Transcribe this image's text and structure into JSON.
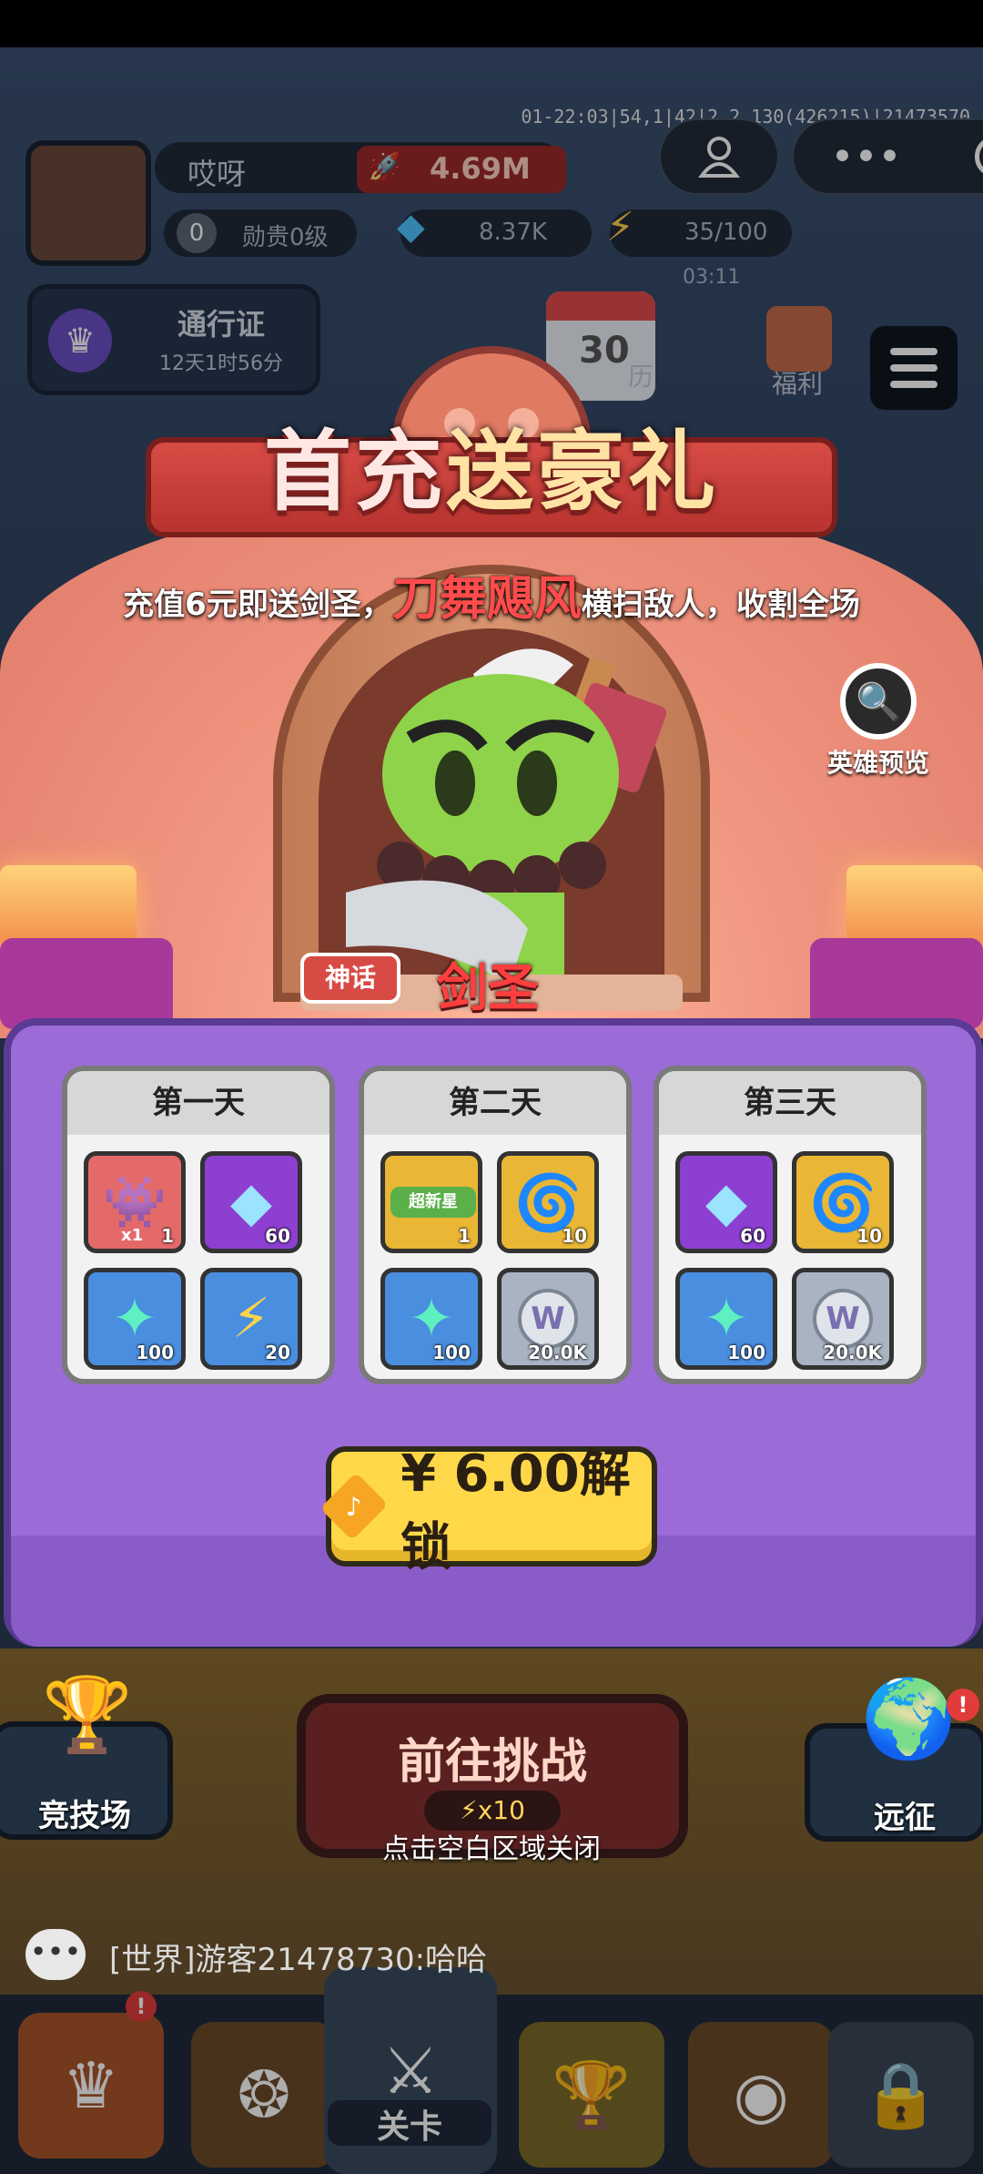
{
  "debug": {
    "info": "01-22:03|54,1|42|2.2.130(426215)|21473570"
  },
  "player": {
    "name": "哎呀",
    "power": "4.69M",
    "medal_level": "勋贵0级",
    "medal_number": "0",
    "gems": "8.37K",
    "energy": "35/100",
    "energy_timer": "03:11"
  },
  "pass": {
    "label": "通行证",
    "timer": "12天1时56分"
  },
  "hud": {
    "calendar_day": "30",
    "calendar_label": "历",
    "welfare": "福利"
  },
  "popup": {
    "title_a": "首充",
    "title_b": "送豪礼",
    "subtitle_pre": "充值6元即送剑圣，",
    "subtitle_highlight": "刀舞飓风",
    "subtitle_post": "横扫敌人，收割全场",
    "hero_preview": "英雄预览",
    "rarity_badge": "神话",
    "hero_name": "剑圣",
    "days": [
      {
        "title": "第一天",
        "items": [
          {
            "icon": "hero-card-icon",
            "qty": "1",
            "badge": "x1"
          },
          {
            "icon": "diamond-icon",
            "qty": "60"
          },
          {
            "icon": "star-shard-icon",
            "qty": "100"
          },
          {
            "icon": "lightning-icon",
            "qty": "20"
          }
        ]
      },
      {
        "title": "第二天",
        "items": [
          {
            "icon": "super-new-ticket-icon",
            "qty": "1",
            "badge": "超新星"
          },
          {
            "icon": "swirl-card-icon",
            "qty": "10"
          },
          {
            "icon": "star-shard-icon",
            "qty": "100"
          },
          {
            "icon": "w-coin-icon",
            "qty": "20.0K"
          }
        ]
      },
      {
        "title": "第三天",
        "items": [
          {
            "icon": "diamond-icon",
            "qty": "60"
          },
          {
            "icon": "swirl-card-icon",
            "qty": "10"
          },
          {
            "icon": "star-shard-icon",
            "qty": "100"
          },
          {
            "icon": "w-coin-icon",
            "qty": "20.0K"
          }
        ]
      }
    ],
    "unlock_label": "¥ 6.00解锁",
    "close_hint": "点击空白区域关闭"
  },
  "bottom": {
    "arena": "竞技场",
    "challenge": "前往挑战",
    "challenge_cost": "x10",
    "expedition": "远征",
    "chat": "[世界]游客21478730:哈哈",
    "tab_stage": "关卡"
  },
  "colors": {
    "accent_red": "#ff3e3e",
    "panel_purple": "#9b6bd8",
    "button_gold": "#ffd84a"
  }
}
